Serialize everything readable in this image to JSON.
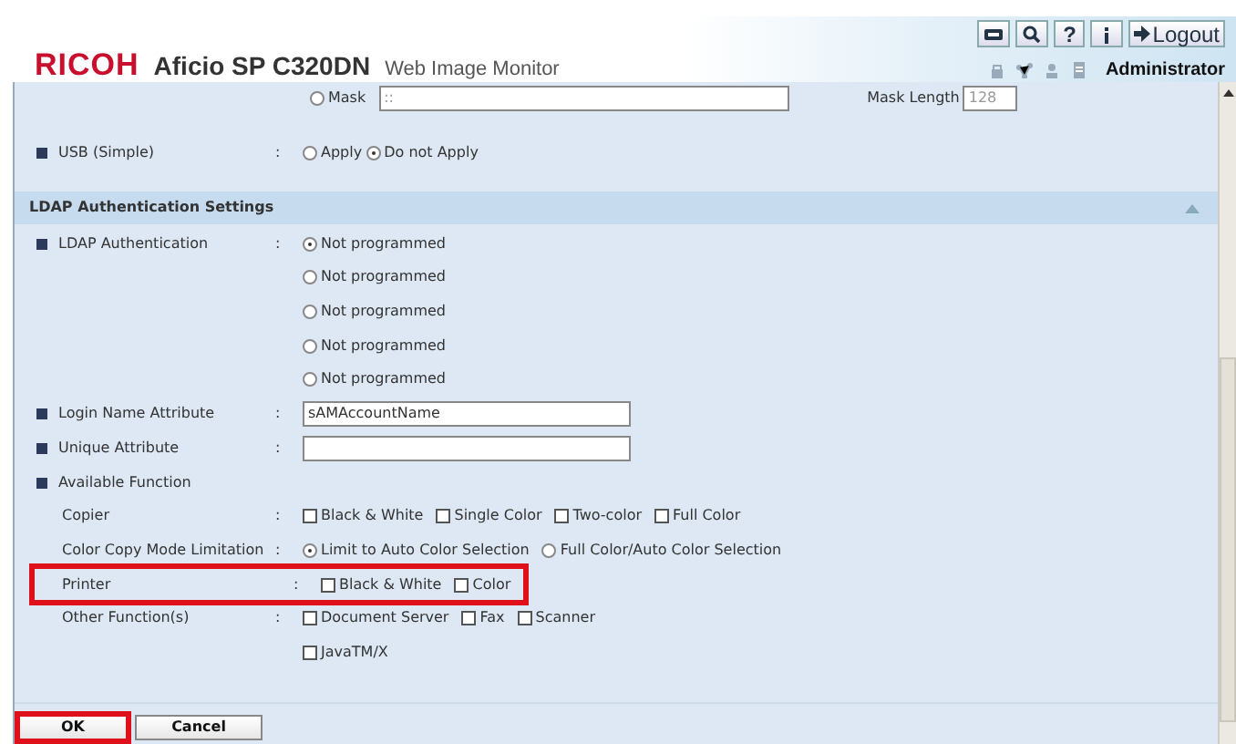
{
  "header": {
    "logo": "RICOH",
    "model": "Aficio SP C320DN",
    "app": "Web Image Monitor",
    "help": "?",
    "logout": "Logout",
    "user": "Administrator"
  },
  "mask_row": {
    "radio_label": "Mask",
    "selected": false,
    "value": "::",
    "length_label": "Mask Length",
    "length_value": "128"
  },
  "usb_row": {
    "label": "USB (Simple)",
    "colon": ":",
    "options": [
      {
        "label": "Apply",
        "selected": false
      },
      {
        "label": "Do not Apply",
        "selected": true
      }
    ]
  },
  "section": {
    "title": "LDAP Authentication Settings"
  },
  "rows": [
    {
      "label": "LDAP Authentication",
      "bullet": true,
      "colon": ":",
      "kind": "radios",
      "highlighted": false,
      "lines": [
        [
          {
            "label": "Not programmed",
            "selected": true
          }
        ],
        [
          {
            "label": "Not programmed",
            "selected": false
          }
        ],
        [
          {
            "label": "Not programmed",
            "selected": false
          }
        ],
        [
          {
            "label": "Not programmed",
            "selected": false
          }
        ],
        [
          {
            "label": "Not programmed",
            "selected": false
          }
        ]
      ]
    },
    {
      "label": "Login Name Attribute",
      "bullet": true,
      "colon": ":",
      "kind": "text",
      "highlighted": false,
      "value": "sAMAccountName"
    },
    {
      "label": "Unique Attribute",
      "bullet": true,
      "colon": ":",
      "kind": "text",
      "highlighted": false,
      "value": ""
    },
    {
      "label": "Available Function",
      "bullet": true,
      "kind": "heading",
      "highlighted": false
    },
    {
      "label": "Copier",
      "bullet": false,
      "colon": ":",
      "kind": "checks",
      "highlighted": false,
      "lines": [
        [
          {
            "label": "Black & White",
            "checked": false
          },
          {
            "label": "Single Color",
            "checked": false
          },
          {
            "label": "Two-color",
            "checked": false
          },
          {
            "label": "Full Color",
            "checked": false
          }
        ]
      ]
    },
    {
      "label": "Color Copy Mode Limitation",
      "bullet": false,
      "colon": ":",
      "kind": "radios",
      "highlighted": false,
      "lines": [
        [
          {
            "label": "Limit to Auto Color Selection",
            "selected": true
          },
          {
            "label": "Full Color/Auto Color Selection",
            "selected": false
          }
        ]
      ]
    },
    {
      "label": "Printer",
      "bullet": false,
      "colon": ":",
      "kind": "checks",
      "highlighted": true,
      "lines": [
        [
          {
            "label": "Black & White",
            "checked": false
          },
          {
            "label": "Color",
            "checked": false
          }
        ]
      ]
    },
    {
      "label": "Other Function(s)",
      "bullet": false,
      "colon": ":",
      "kind": "checks",
      "highlighted": false,
      "lines": [
        [
          {
            "label": "Document Server",
            "checked": false
          },
          {
            "label": "Fax",
            "checked": false
          },
          {
            "label": "Scanner",
            "checked": false
          }
        ],
        [
          {
            "label": "JavaTM/X",
            "checked": false
          }
        ]
      ]
    }
  ],
  "buttons": [
    {
      "label": "OK",
      "highlighted": true
    },
    {
      "label": "Cancel",
      "highlighted": false
    }
  ]
}
